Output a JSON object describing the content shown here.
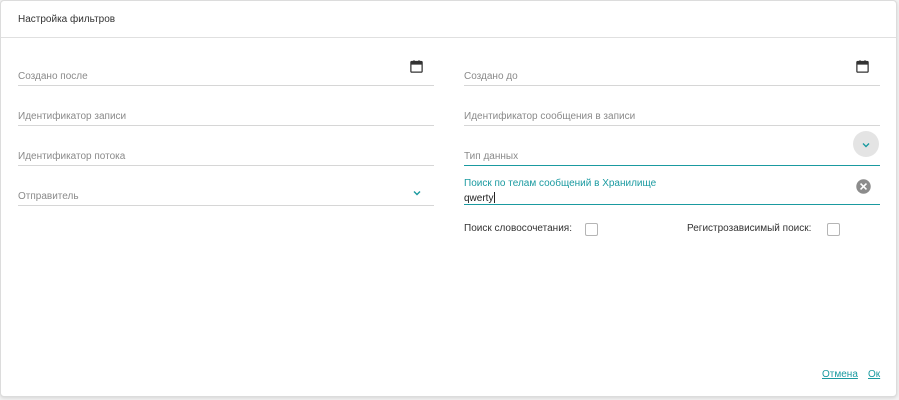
{
  "dialog": {
    "title": "Настройка фильтров"
  },
  "fields": {
    "created_after": {
      "label": "Создано после",
      "icon": "calendar-icon"
    },
    "created_before": {
      "label": "Создано до",
      "icon": "calendar-icon"
    },
    "record_id": {
      "label": "Идентификатор записи"
    },
    "message_id": {
      "label": "Идентификатор сообщения в записи"
    },
    "stream_id": {
      "label": "Идентификатор потока"
    },
    "data_type": {
      "label": "Тип данных",
      "icon": "chevron-down-icon"
    },
    "sender": {
      "label": "Отправитель",
      "icon": "chevron-down-icon"
    },
    "body_search": {
      "label": "Поиск по телам сообщений в Хранилище",
      "value": "qwerty",
      "icon": "clear-icon"
    }
  },
  "options": {
    "phrase_search": {
      "label": "Поиск словосочетания:",
      "checked": false
    },
    "case_sensitive": {
      "label": "Регистрозависимый поиск:",
      "checked": false
    }
  },
  "footer": {
    "cancel_label": "Отмена",
    "ok_label": "Ок"
  },
  "colors": {
    "accent": "#1a9aa0",
    "label": "#8a8a8a",
    "divider": "#d6d6d6"
  }
}
